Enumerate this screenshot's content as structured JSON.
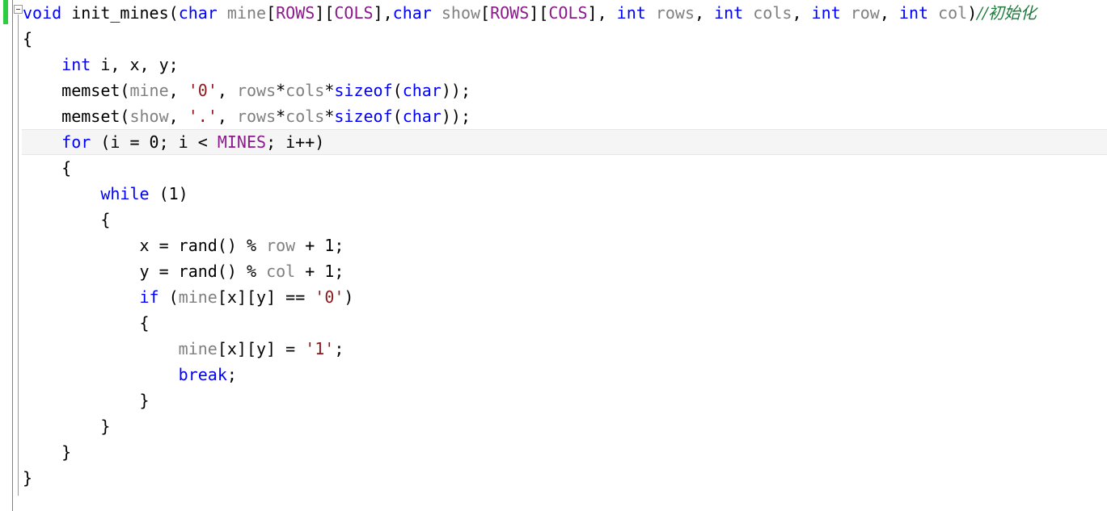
{
  "editor": {
    "language": "C",
    "font_size_px": 20,
    "line_height_px": 32,
    "colors": {
      "background": "#ffffff",
      "keyword": "#0000ff",
      "identifier": "#808080",
      "macro": "#8b1a8b",
      "string": "#8b1a1a",
      "comment": "#1f7a3d",
      "plain": "#000000",
      "current_line_highlight": "#f5f5f6",
      "change_bar": "#2ecc40",
      "gutter_line": "#828282"
    },
    "gutter": {
      "change_bar_label": "unsaved-change-marker",
      "fold_marker_label": "collapse-block",
      "fold_marker_glyph": "-"
    },
    "current_line_number": 6,
    "lines": [
      {
        "n": 1,
        "indent": 0,
        "tokens": [
          {
            "t": "void",
            "c": "kw"
          },
          {
            "t": " ",
            "c": "pl"
          },
          {
            "t": "init_mines",
            "c": "pl"
          },
          {
            "t": "(",
            "c": "pl"
          },
          {
            "t": "char",
            "c": "kw"
          },
          {
            "t": " ",
            "c": "pl"
          },
          {
            "t": "mine",
            "c": "id"
          },
          {
            "t": "[",
            "c": "pl"
          },
          {
            "t": "ROWS",
            "c": "pp"
          },
          {
            "t": "][",
            "c": "pl"
          },
          {
            "t": "COLS",
            "c": "pp"
          },
          {
            "t": "],",
            "c": "pl"
          },
          {
            "t": "char",
            "c": "kw"
          },
          {
            "t": " ",
            "c": "pl"
          },
          {
            "t": "show",
            "c": "id"
          },
          {
            "t": "[",
            "c": "pl"
          },
          {
            "t": "ROWS",
            "c": "pp"
          },
          {
            "t": "][",
            "c": "pl"
          },
          {
            "t": "COLS",
            "c": "pp"
          },
          {
            "t": "], ",
            "c": "pl"
          },
          {
            "t": "int",
            "c": "kw"
          },
          {
            "t": " ",
            "c": "pl"
          },
          {
            "t": "rows",
            "c": "id"
          },
          {
            "t": ", ",
            "c": "pl"
          },
          {
            "t": "int",
            "c": "kw"
          },
          {
            "t": " ",
            "c": "pl"
          },
          {
            "t": "cols",
            "c": "id"
          },
          {
            "t": ", ",
            "c": "pl"
          },
          {
            "t": "int",
            "c": "kw"
          },
          {
            "t": " ",
            "c": "pl"
          },
          {
            "t": "row",
            "c": "id"
          },
          {
            "t": ", ",
            "c": "pl"
          },
          {
            "t": "int",
            "c": "kw"
          },
          {
            "t": " ",
            "c": "pl"
          },
          {
            "t": "col",
            "c": "id"
          },
          {
            "t": ")",
            "c": "pl"
          },
          {
            "t": "//初始化",
            "c": "cmt"
          }
        ]
      },
      {
        "n": 2,
        "indent": 0,
        "tokens": [
          {
            "t": "{",
            "c": "pl"
          }
        ]
      },
      {
        "n": 3,
        "indent": 1,
        "tokens": [
          {
            "t": "int",
            "c": "kw"
          },
          {
            "t": " i, x, y;",
            "c": "pl"
          }
        ]
      },
      {
        "n": 4,
        "indent": 1,
        "tokens": [
          {
            "t": "memset",
            "c": "pl"
          },
          {
            "t": "(",
            "c": "pl"
          },
          {
            "t": "mine",
            "c": "id"
          },
          {
            "t": ", ",
            "c": "pl"
          },
          {
            "t": "'0'",
            "c": "str"
          },
          {
            "t": ", ",
            "c": "pl"
          },
          {
            "t": "rows",
            "c": "id"
          },
          {
            "t": "*",
            "c": "pl"
          },
          {
            "t": "cols",
            "c": "id"
          },
          {
            "t": "*",
            "c": "pl"
          },
          {
            "t": "sizeof",
            "c": "kw"
          },
          {
            "t": "(",
            "c": "pl"
          },
          {
            "t": "char",
            "c": "kw"
          },
          {
            "t": "));",
            "c": "pl"
          }
        ]
      },
      {
        "n": 5,
        "indent": 1,
        "tokens": [
          {
            "t": "memset",
            "c": "pl"
          },
          {
            "t": "(",
            "c": "pl"
          },
          {
            "t": "show",
            "c": "id"
          },
          {
            "t": ", ",
            "c": "pl"
          },
          {
            "t": "'.'",
            "c": "str"
          },
          {
            "t": ", ",
            "c": "pl"
          },
          {
            "t": "rows",
            "c": "id"
          },
          {
            "t": "*",
            "c": "pl"
          },
          {
            "t": "cols",
            "c": "id"
          },
          {
            "t": "*",
            "c": "pl"
          },
          {
            "t": "sizeof",
            "c": "kw"
          },
          {
            "t": "(",
            "c": "pl"
          },
          {
            "t": "char",
            "c": "kw"
          },
          {
            "t": "));",
            "c": "pl"
          }
        ]
      },
      {
        "n": 6,
        "indent": 1,
        "highlight": true,
        "tokens": [
          {
            "t": "for",
            "c": "kw"
          },
          {
            "t": " (i = 0; i < ",
            "c": "pl"
          },
          {
            "t": "MINES",
            "c": "pp"
          },
          {
            "t": "; i++)",
            "c": "pl"
          }
        ]
      },
      {
        "n": 7,
        "indent": 1,
        "tokens": [
          {
            "t": "{",
            "c": "pl"
          }
        ]
      },
      {
        "n": 8,
        "indent": 2,
        "tokens": [
          {
            "t": "while",
            "c": "kw"
          },
          {
            "t": " (1)",
            "c": "pl"
          }
        ]
      },
      {
        "n": 9,
        "indent": 2,
        "tokens": [
          {
            "t": "{",
            "c": "pl"
          }
        ]
      },
      {
        "n": 10,
        "indent": 3,
        "tokens": [
          {
            "t": "x = ",
            "c": "pl"
          },
          {
            "t": "rand",
            "c": "pl"
          },
          {
            "t": "() % ",
            "c": "pl"
          },
          {
            "t": "row",
            "c": "id"
          },
          {
            "t": " + 1;",
            "c": "pl"
          }
        ]
      },
      {
        "n": 11,
        "indent": 3,
        "tokens": [
          {
            "t": "y = ",
            "c": "pl"
          },
          {
            "t": "rand",
            "c": "pl"
          },
          {
            "t": "() % ",
            "c": "pl"
          },
          {
            "t": "col",
            "c": "id"
          },
          {
            "t": " + 1;",
            "c": "pl"
          }
        ]
      },
      {
        "n": 12,
        "indent": 3,
        "tokens": [
          {
            "t": "if",
            "c": "kw"
          },
          {
            "t": " (",
            "c": "pl"
          },
          {
            "t": "mine",
            "c": "id"
          },
          {
            "t": "[x][y] == ",
            "c": "pl"
          },
          {
            "t": "'0'",
            "c": "str"
          },
          {
            "t": ")",
            "c": "pl"
          }
        ]
      },
      {
        "n": 13,
        "indent": 3,
        "tokens": [
          {
            "t": "{",
            "c": "pl"
          }
        ]
      },
      {
        "n": 14,
        "indent": 4,
        "tokens": [
          {
            "t": "mine",
            "c": "id"
          },
          {
            "t": "[x][y] = ",
            "c": "pl"
          },
          {
            "t": "'1'",
            "c": "str"
          },
          {
            "t": ";",
            "c": "pl"
          }
        ]
      },
      {
        "n": 15,
        "indent": 4,
        "tokens": [
          {
            "t": "break",
            "c": "kw"
          },
          {
            "t": ";",
            "c": "pl"
          }
        ]
      },
      {
        "n": 16,
        "indent": 3,
        "tokens": [
          {
            "t": "}",
            "c": "pl"
          }
        ]
      },
      {
        "n": 17,
        "indent": 2,
        "tokens": [
          {
            "t": "}",
            "c": "pl"
          }
        ]
      },
      {
        "n": 18,
        "indent": 1,
        "tokens": [
          {
            "t": "}",
            "c": "pl"
          }
        ]
      },
      {
        "n": 19,
        "indent": 0,
        "tokens": [
          {
            "t": "}",
            "c": "pl"
          }
        ]
      }
    ]
  }
}
